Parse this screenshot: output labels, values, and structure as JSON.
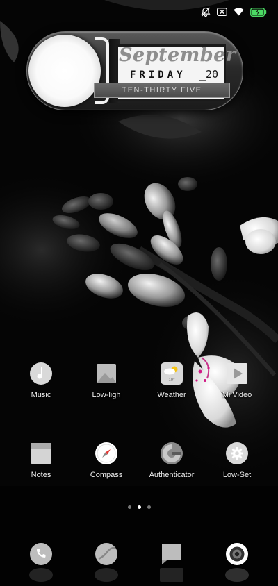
{
  "status_bar": {
    "icons": [
      "notifications-off-icon",
      "sim-card-icon",
      "wifi-icon",
      "battery-charging-icon"
    ],
    "battery_color": "#4cd964"
  },
  "widget": {
    "month": "September",
    "day": "FRIDAY",
    "date": "_20",
    "time_text": "TEN-THIRTY FIVE"
  },
  "apps": [
    {
      "label": "Music",
      "icon": "music-icon"
    },
    {
      "label": "Low-ligh",
      "icon": "image-icon"
    },
    {
      "label": "Weather",
      "icon": "weather-icon",
      "badge": "19°"
    },
    {
      "label": "Mi Video",
      "icon": "play-icon"
    },
    {
      "label": "Notes",
      "icon": "notes-icon"
    },
    {
      "label": "Compass",
      "icon": "compass-icon"
    },
    {
      "label": "Authenticator",
      "icon": "authenticator-icon"
    },
    {
      "label": "Low-Set",
      "icon": "gear-icon"
    }
  ],
  "page_indicator": {
    "pages": 3,
    "current": 2
  },
  "dock": [
    {
      "icon": "phone-icon"
    },
    {
      "icon": "browser-icon"
    },
    {
      "icon": "messages-icon"
    },
    {
      "icon": "camera-icon"
    }
  ]
}
